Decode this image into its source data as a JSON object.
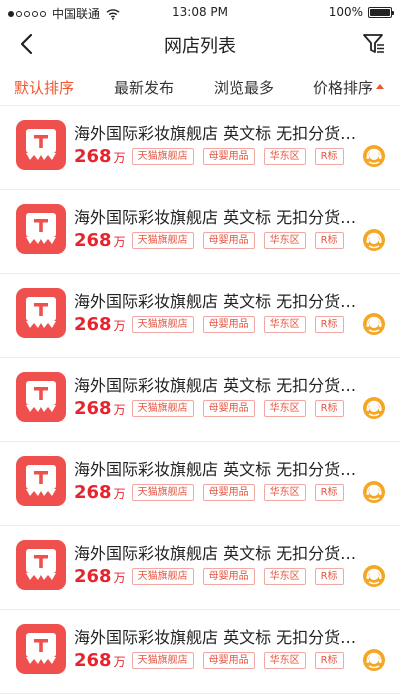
{
  "status_bar": {
    "carrier": "中国联通",
    "time": "13:08 PM",
    "battery": "100%",
    "signal_bars_filled": 1,
    "signal_bars_total": 5
  },
  "header": {
    "title": "网店列表",
    "back_icon": "chevron-left-icon",
    "filter_icon": "filter-icon"
  },
  "tabs": [
    {
      "label": "默认排序",
      "active": true
    },
    {
      "label": "最新发布",
      "active": false
    },
    {
      "label": "浏览最多",
      "active": false
    },
    {
      "label": "价格排序",
      "active": false,
      "sort_icon": "sort-up-icon"
    }
  ],
  "colors": {
    "accent": "#f2552c",
    "price": "#e8232d",
    "logo_bg": "#f0504d",
    "service_icon": "#f5a623"
  },
  "shops": [
    {
      "name": "海外国际彩妆旗舰店 英文标 无扣分货…",
      "price": "268",
      "unit": "万",
      "tags": [
        "天猫旗舰店",
        "母婴用品",
        "华东区",
        "R标"
      ]
    },
    {
      "name": "海外国际彩妆旗舰店 英文标 无扣分货…",
      "price": "268",
      "unit": "万",
      "tags": [
        "天猫旗舰店",
        "母婴用品",
        "华东区",
        "R标"
      ]
    },
    {
      "name": "海外国际彩妆旗舰店 英文标 无扣分货…",
      "price": "268",
      "unit": "万",
      "tags": [
        "天猫旗舰店",
        "母婴用品",
        "华东区",
        "R标"
      ]
    },
    {
      "name": "海外国际彩妆旗舰店 英文标 无扣分货…",
      "price": "268",
      "unit": "万",
      "tags": [
        "天猫旗舰店",
        "母婴用品",
        "华东区",
        "R标"
      ]
    },
    {
      "name": "海外国际彩妆旗舰店 英文标 无扣分货…",
      "price": "268",
      "unit": "万",
      "tags": [
        "天猫旗舰店",
        "母婴用品",
        "华东区",
        "R标"
      ]
    },
    {
      "name": "海外国际彩妆旗舰店 英文标 无扣分货…",
      "price": "268",
      "unit": "万",
      "tags": [
        "天猫旗舰店",
        "母婴用品",
        "华东区",
        "R标"
      ]
    },
    {
      "name": "海外国际彩妆旗舰店 英文标 无扣分货…",
      "price": "268",
      "unit": "万",
      "tags": [
        "天猫旗舰店",
        "母婴用品",
        "华东区",
        "R标"
      ]
    }
  ]
}
